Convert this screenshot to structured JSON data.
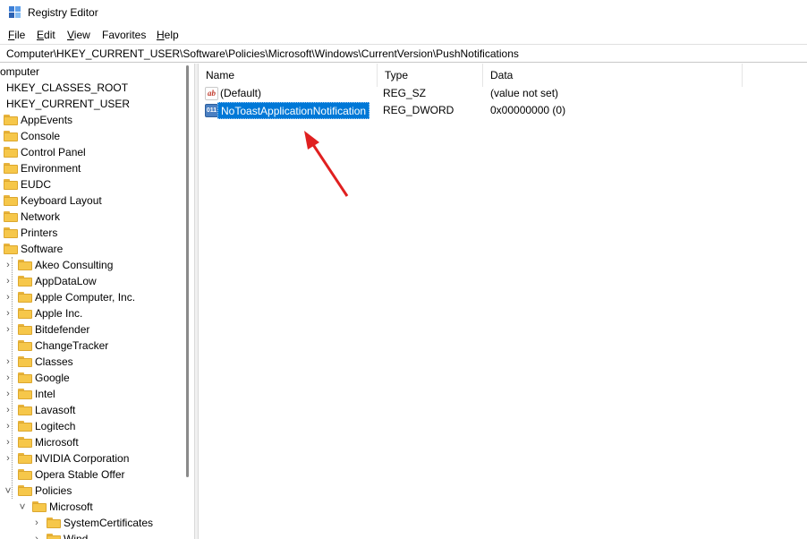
{
  "window": {
    "title": "Registry Editor"
  },
  "menu": [
    {
      "label": "File",
      "key": "F",
      "rest": "ile"
    },
    {
      "label": "Edit",
      "key": "E",
      "rest": "dit"
    },
    {
      "label": "View",
      "key": "V",
      "rest": "iew"
    },
    {
      "label": "Favorites",
      "key": "",
      "rest": "Favorites",
      "key_index": 1
    },
    {
      "label": "Help",
      "key": "H",
      "rest": "elp"
    }
  ],
  "address": "Computer\\HKEY_CURRENT_USER\\Software\\Policies\\Microsoft\\Windows\\CurrentVersion\\PushNotifications",
  "tree": {
    "root": "omputer",
    "hives": [
      "HKEY_CLASSES_ROOT",
      "HKEY_CURRENT_USER"
    ],
    "hkcu_children": [
      "AppEvents",
      "Console",
      "Control Panel",
      "Environment",
      "EUDC",
      "Keyboard Layout",
      "Network",
      "Printers",
      "Software"
    ],
    "software_children": [
      {
        "label": "Akeo Consulting",
        "expandable": true
      },
      {
        "label": "AppDataLow",
        "expandable": true
      },
      {
        "label": "Apple Computer, Inc.",
        "expandable": true
      },
      {
        "label": "Apple Inc.",
        "expandable": true
      },
      {
        "label": "Bitdefender",
        "expandable": true
      },
      {
        "label": "ChangeTracker",
        "expandable": false
      },
      {
        "label": "Classes",
        "expandable": true
      },
      {
        "label": "Google",
        "expandable": true
      },
      {
        "label": "Intel",
        "expandable": true
      },
      {
        "label": "Lavasoft",
        "expandable": true
      },
      {
        "label": "Logitech",
        "expandable": true
      },
      {
        "label": "Microsoft",
        "expandable": true
      },
      {
        "label": "NVIDIA Corporation",
        "expandable": true
      },
      {
        "label": "Opera Stable Offer",
        "expandable": false
      },
      {
        "label": "Policies",
        "expandable": true,
        "expanded": true
      }
    ],
    "policies_children": [
      {
        "label": "Microsoft",
        "expanded": true
      }
    ],
    "policies_ms_children": [
      {
        "label": "SystemCertificates"
      },
      {
        "label": "Wind"
      }
    ]
  },
  "list": {
    "columns": [
      "Name",
      "Type",
      "Data"
    ],
    "rows": [
      {
        "name": "(Default)",
        "type": "REG_SZ",
        "data": "(value not set)",
        "icon": "reg-sz-icon",
        "selected": false
      },
      {
        "name": "NoToastApplicationNotification",
        "type": "REG_DWORD",
        "data": "0x00000000 (0)",
        "icon": "reg-dword-icon",
        "selected": true
      }
    ]
  },
  "annotation": {
    "arrow_color": "#e02020"
  },
  "colors": {
    "selection": "#0078d7",
    "folder": "#f6c74a"
  }
}
